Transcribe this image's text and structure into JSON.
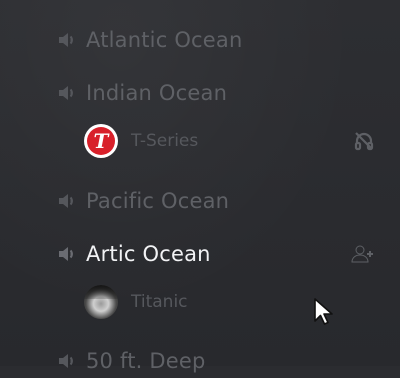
{
  "channels": [
    {
      "label": "Atlantic Ocean",
      "icon": "speaker-icon"
    },
    {
      "label": "Indian Ocean",
      "icon": "speaker-icon"
    },
    {
      "label": "Pacific Ocean",
      "icon": "speaker-icon"
    },
    {
      "label": "Artic Ocean",
      "icon": "speaker-icon"
    },
    {
      "label": "50 ft. Deep",
      "icon": "speaker-icon"
    }
  ],
  "members": [
    {
      "name": "T-Series",
      "avatar_letter": "T",
      "avatar_color": "#d8202a",
      "status_icon": "deafened-icon"
    },
    {
      "name": "Titanic",
      "avatar": "titanic-avatar"
    }
  ],
  "active_channel_action_icon": "invite-member-icon",
  "colors": {
    "background": "#2b2c30",
    "muted_text": "#5f6166",
    "active_text": "#f2f3f5"
  }
}
